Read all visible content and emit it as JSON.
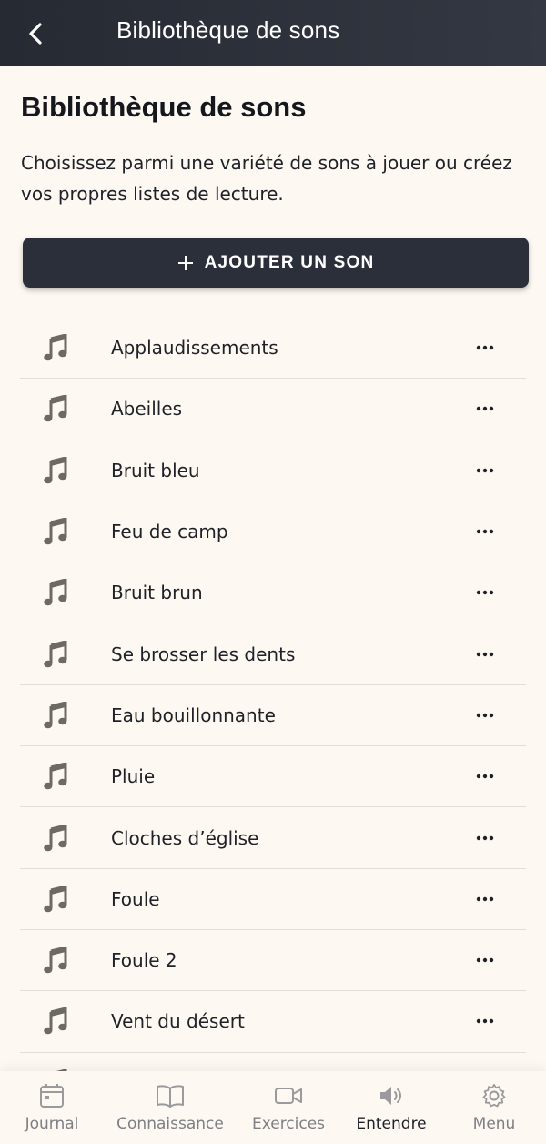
{
  "topbar": {
    "title": "Bibliothèque de sons",
    "back_icon": "chevron-left-icon"
  },
  "page": {
    "title": "Bibliothèque de sons",
    "description": "Choisissez parmi une variété de sons à jouer ou créez vos propres listes de lecture."
  },
  "add_button": {
    "label": "AJOUTER UN SON",
    "icon": "plus-icon"
  },
  "sounds": [
    {
      "label": "Applaudissements"
    },
    {
      "label": "Abeilles"
    },
    {
      "label": "Bruit bleu"
    },
    {
      "label": "Feu de camp"
    },
    {
      "label": "Bruit brun"
    },
    {
      "label": "Se brosser les dents"
    },
    {
      "label": "Eau bouillonnante"
    },
    {
      "label": "Pluie"
    },
    {
      "label": "Cloches d’église"
    },
    {
      "label": "Foule"
    },
    {
      "label": "Foule 2"
    },
    {
      "label": "Vent du désert"
    },
    {
      "label": ""
    }
  ],
  "tabs": [
    {
      "label": "Journal",
      "icon": "calendar-icon",
      "active": false
    },
    {
      "label": "Connaissance",
      "icon": "book-icon",
      "active": false
    },
    {
      "label": "Exercices",
      "icon": "video-camera-icon",
      "active": false
    },
    {
      "label": "Entendre",
      "icon": "speaker-icon",
      "active": true
    },
    {
      "label": "Menu",
      "icon": "gear-icon",
      "active": false
    }
  ],
  "colors": {
    "background": "#fdf8f1",
    "header": "#2b2f39",
    "accent_icon": "#6d6a63",
    "inactive_tab": "#7d7f84"
  }
}
